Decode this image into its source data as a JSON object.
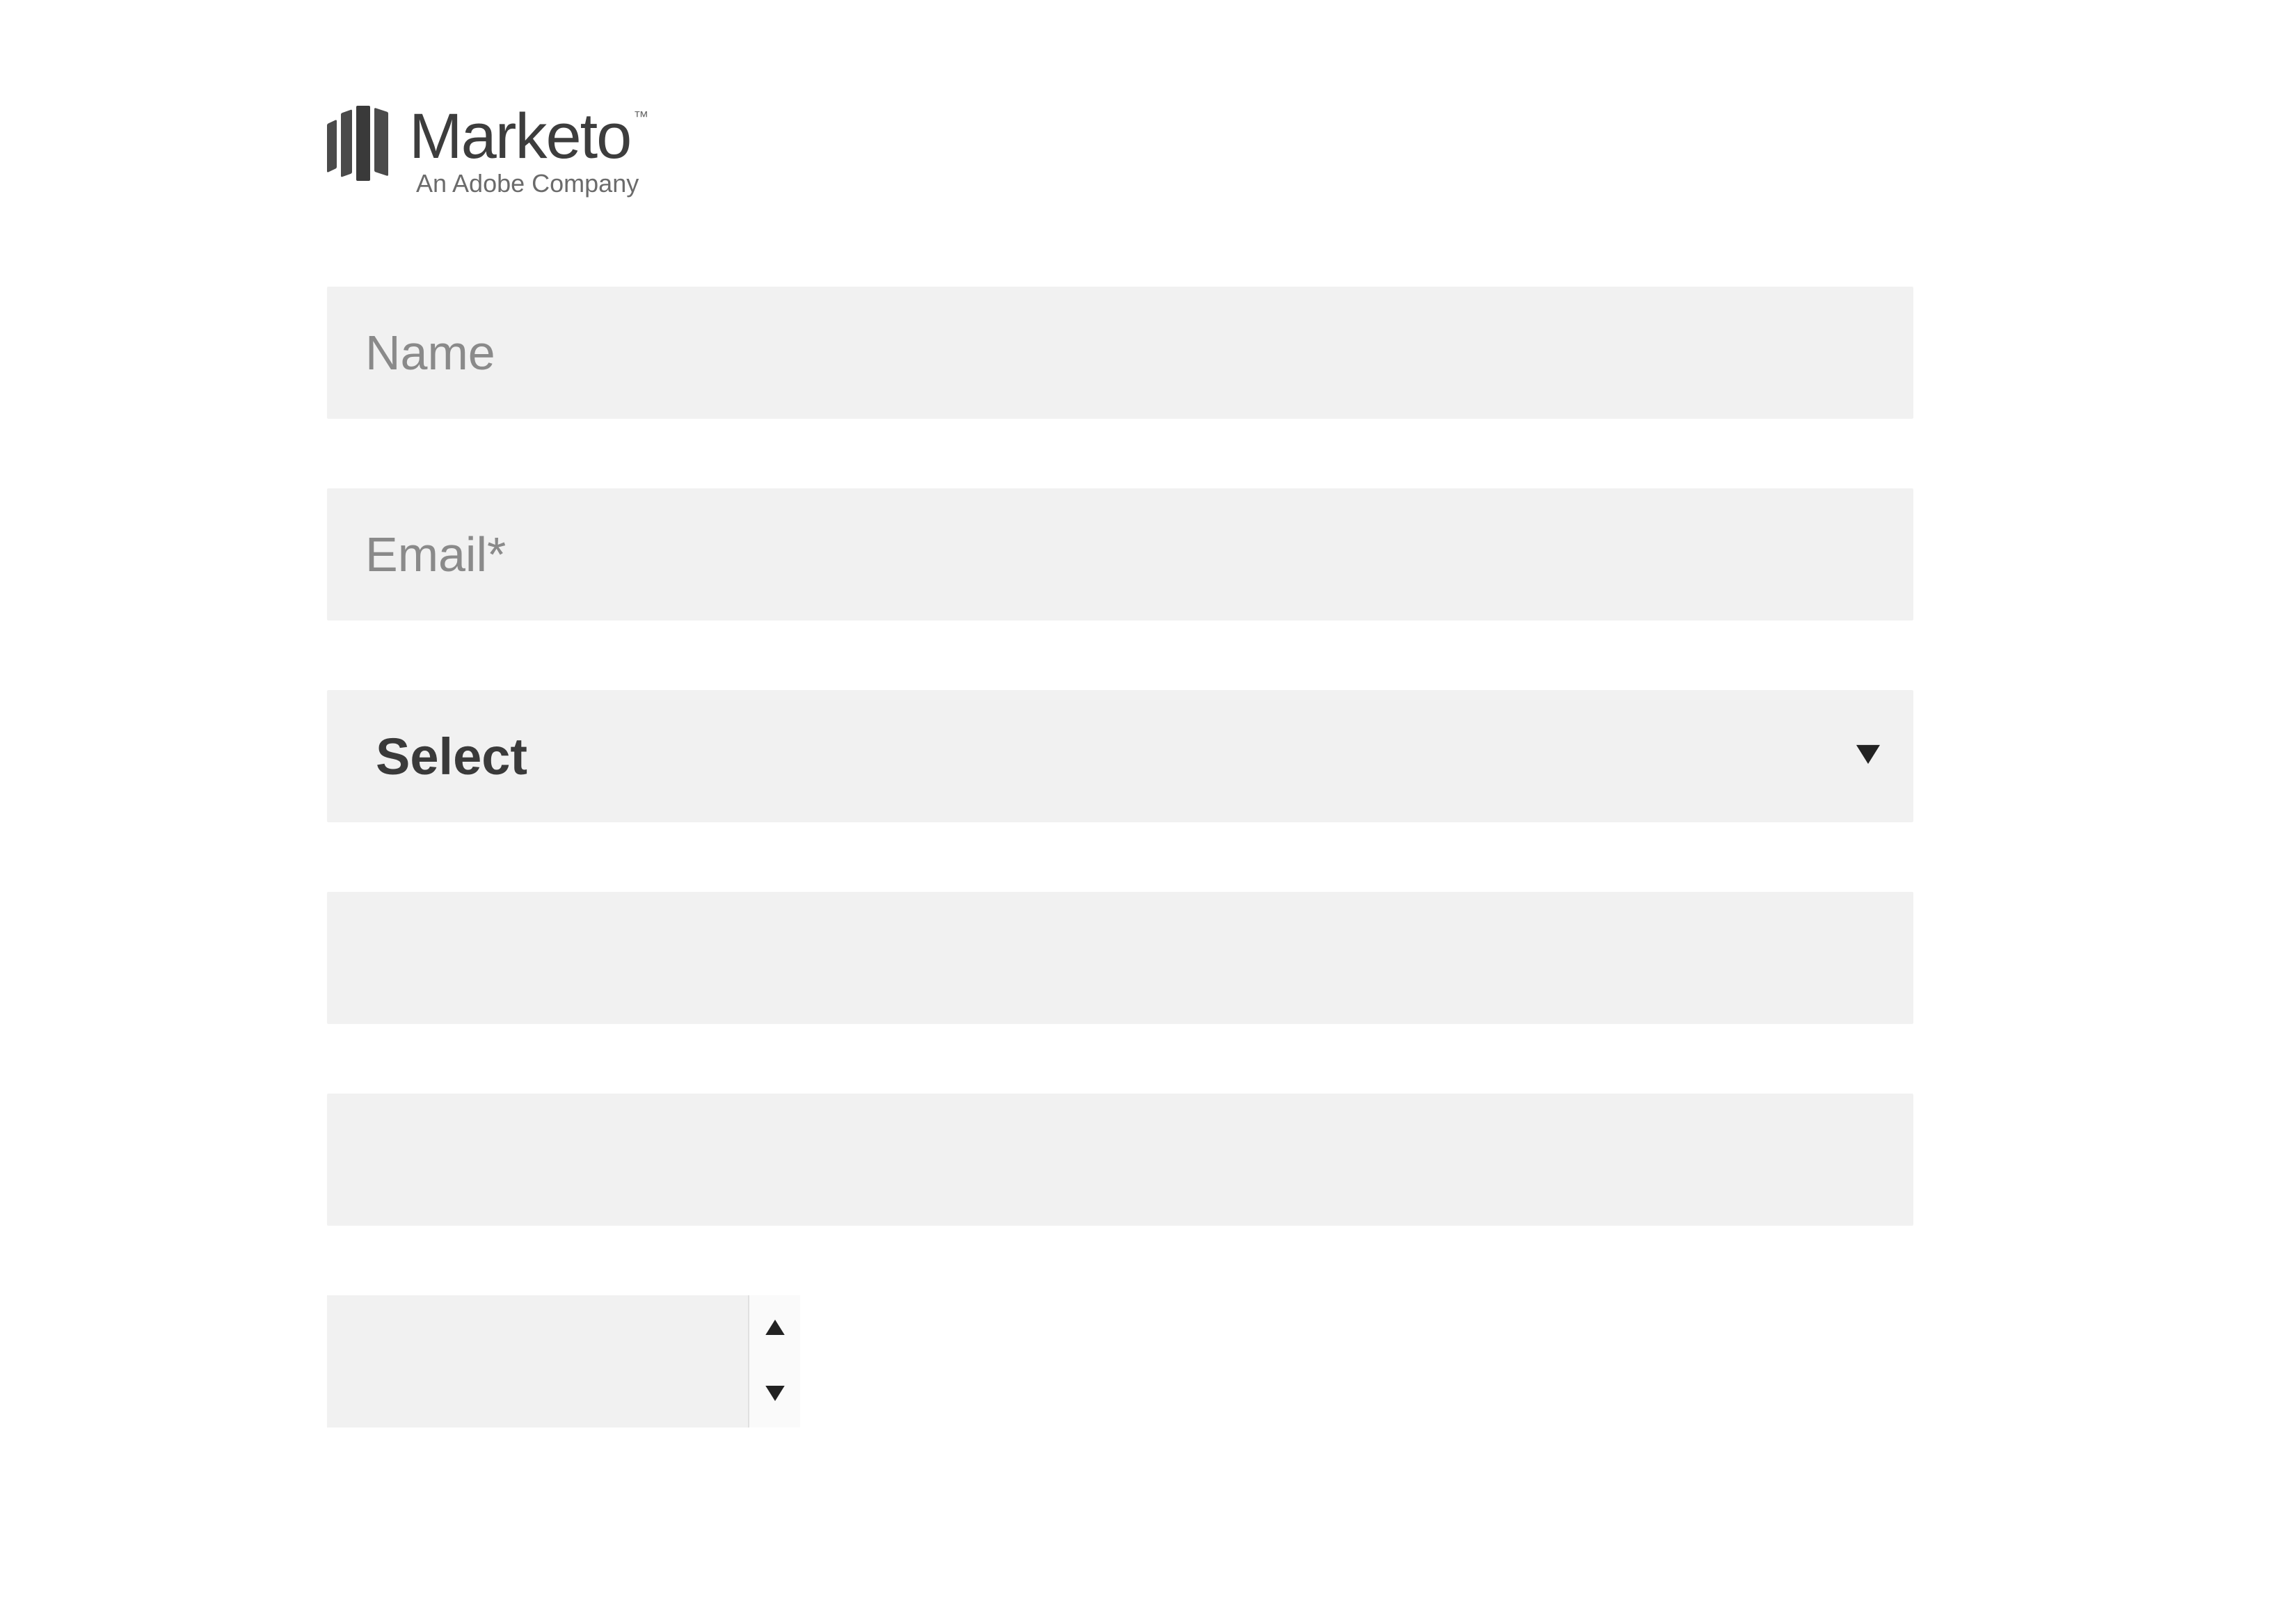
{
  "logo": {
    "brand": "Marketo",
    "trademark": "™",
    "tagline": "An Adobe Company"
  },
  "form": {
    "name_placeholder": "Name",
    "name_value": "",
    "email_placeholder": "Email*",
    "email_value": "",
    "select_value": "Select",
    "field4_placeholder": "",
    "field4_value": "",
    "field5_placeholder": "",
    "field5_value": "",
    "number_value": ""
  }
}
